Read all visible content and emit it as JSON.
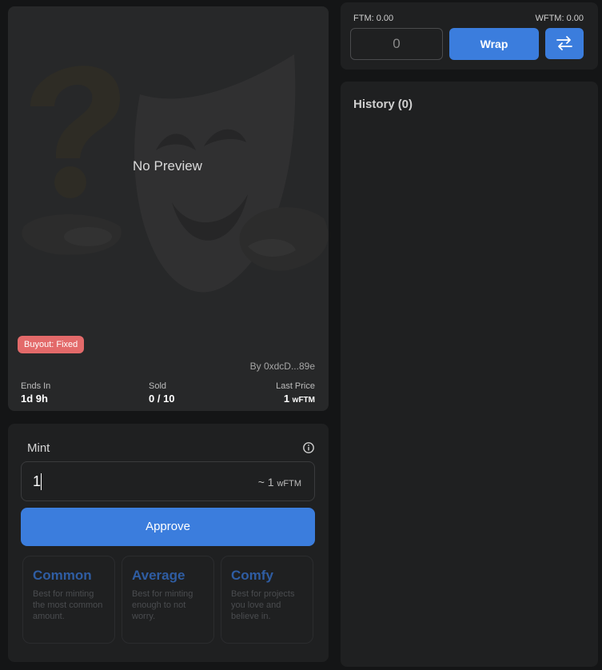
{
  "nft": {
    "preview_text": "No Preview",
    "buyout_badge": "Buyout: Fixed",
    "creator": "By 0xdcD...89e",
    "stats": {
      "ends_in_label": "Ends In",
      "ends_in_value": "1d 9h",
      "sold_label": "Sold",
      "sold_value": "0 / 10",
      "last_price_label": "Last Price",
      "last_price_value": "1",
      "last_price_unit": "wFTM"
    }
  },
  "mint": {
    "title": "Mint",
    "quantity_value": "1",
    "estimate_prefix": "~ 1",
    "estimate_unit": "wFTM",
    "approve_label": "Approve",
    "options": [
      {
        "title": "Common",
        "description": "Best for minting the most common amount."
      },
      {
        "title": "Average",
        "description": "Best for minting enough to not worry."
      },
      {
        "title": "Comfy",
        "description": "Best for projects you love and believe in."
      }
    ]
  },
  "wrap": {
    "ftm_balance": "FTM: 0.00",
    "wftm_balance": "WFTM: 0.00",
    "amount_value": "0",
    "wrap_label": "Wrap"
  },
  "history": {
    "title": "History",
    "count": "(0)"
  },
  "colors": {
    "accent": "#3b7ddd",
    "badge": "#e36a6a",
    "option_title": "#2f5da3"
  },
  "icons": {
    "info": "info-icon",
    "swap": "swap-arrows-icon",
    "placeholder_art": "theater-mask-question-icon"
  }
}
